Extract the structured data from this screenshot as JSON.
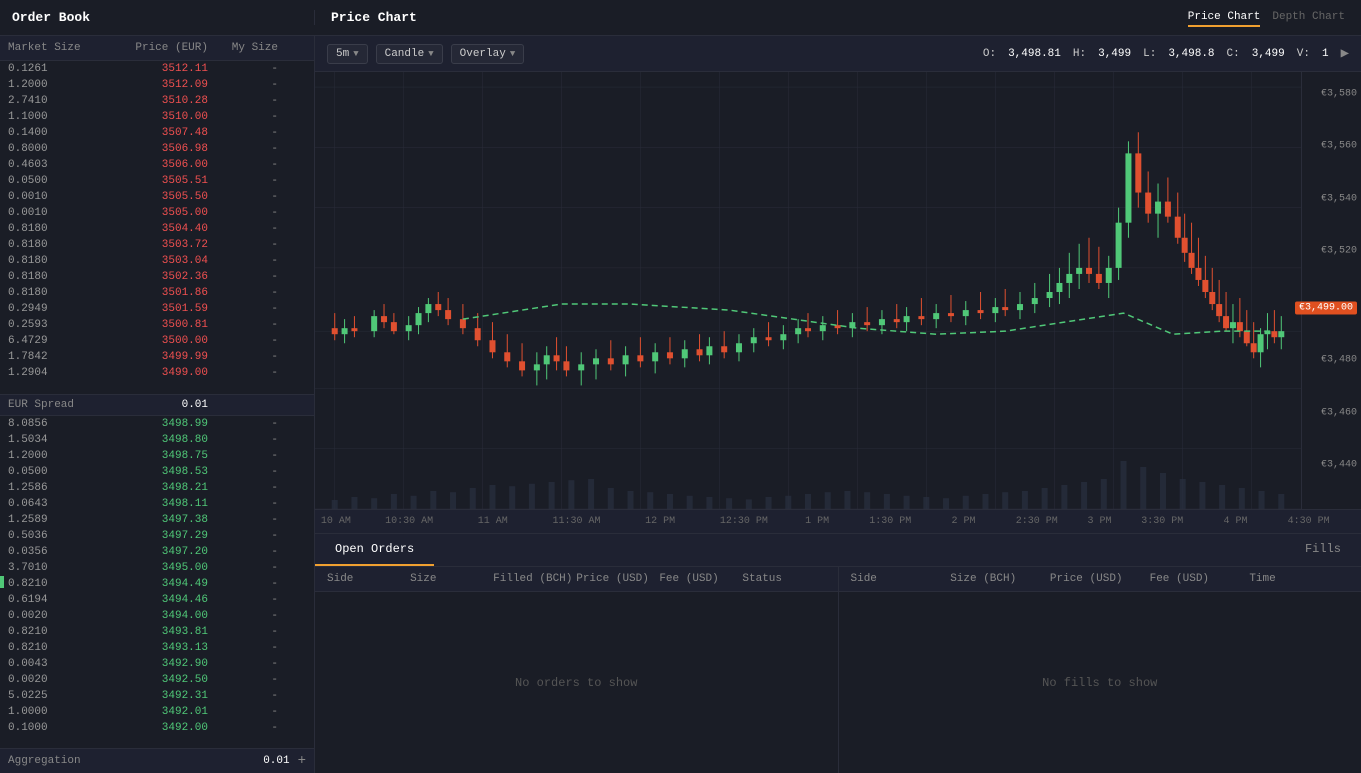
{
  "header": {
    "order_book_title": "Order Book",
    "price_chart_title": "Price Chart",
    "chart_tabs": [
      {
        "label": "Price Chart",
        "active": true
      },
      {
        "label": "Depth Chart",
        "active": false
      }
    ]
  },
  "controls": {
    "timeframe": "5m",
    "chart_type": "Candle",
    "overlay": "Overlay",
    "ohlcv": {
      "o_label": "O:",
      "o_val": "3,498.81",
      "h_label": "H:",
      "h_val": "3,499",
      "l_label": "L:",
      "l_val": "3,498.8",
      "c_label": "C:",
      "c_val": "3,499",
      "v_label": "V:",
      "v_val": "1"
    }
  },
  "order_book": {
    "columns": [
      "Market Size",
      "Price (EUR)",
      "My Size"
    ],
    "asks": [
      {
        "market_size": "0.1261",
        "price": "3512.11",
        "my_size": "-"
      },
      {
        "market_size": "1.2000",
        "price": "3512.09",
        "my_size": "-"
      },
      {
        "market_size": "2.7410",
        "price": "3510.28",
        "my_size": "-"
      },
      {
        "market_size": "1.1000",
        "price": "3510.00",
        "my_size": "-"
      },
      {
        "market_size": "0.1400",
        "price": "3507.48",
        "my_size": "-"
      },
      {
        "market_size": "0.8000",
        "price": "3506.98",
        "my_size": "-"
      },
      {
        "market_size": "0.4603",
        "price": "3506.00",
        "my_size": "-"
      },
      {
        "market_size": "0.0500",
        "price": "3505.51",
        "my_size": "-"
      },
      {
        "market_size": "0.0010",
        "price": "3505.50",
        "my_size": "-"
      },
      {
        "market_size": "0.0010",
        "price": "3505.00",
        "my_size": "-"
      },
      {
        "market_size": "0.8180",
        "price": "3504.40",
        "my_size": "-"
      },
      {
        "market_size": "0.8180",
        "price": "3503.72",
        "my_size": "-"
      },
      {
        "market_size": "0.8180",
        "price": "3503.04",
        "my_size": "-"
      },
      {
        "market_size": "0.8180",
        "price": "3502.36",
        "my_size": "-"
      },
      {
        "market_size": "0.8180",
        "price": "3501.86",
        "my_size": "-"
      },
      {
        "market_size": "0.2949",
        "price": "3501.59",
        "my_size": "-"
      },
      {
        "market_size": "0.2593",
        "price": "3500.81",
        "my_size": "-"
      },
      {
        "market_size": "6.4729",
        "price": "3500.00",
        "my_size": "-"
      },
      {
        "market_size": "1.7842",
        "price": "3499.99",
        "my_size": "-"
      },
      {
        "market_size": "1.2904",
        "price": "3499.00",
        "my_size": "-"
      }
    ],
    "spread_label": "EUR Spread",
    "spread_value": "0.01",
    "bids": [
      {
        "market_size": "8.0856",
        "price": "3498.99",
        "my_size": "-"
      },
      {
        "market_size": "1.5034",
        "price": "3498.80",
        "my_size": "-"
      },
      {
        "market_size": "1.2000",
        "price": "3498.75",
        "my_size": "-"
      },
      {
        "market_size": "0.0500",
        "price": "3498.53",
        "my_size": "-"
      },
      {
        "market_size": "1.2586",
        "price": "3498.21",
        "my_size": "-"
      },
      {
        "market_size": "0.0643",
        "price": "3498.11",
        "my_size": "-"
      },
      {
        "market_size": "1.2589",
        "price": "3497.38",
        "my_size": "-"
      },
      {
        "market_size": "0.5036",
        "price": "3497.29",
        "my_size": "-"
      },
      {
        "market_size": "0.0356",
        "price": "3497.20",
        "my_size": "-"
      },
      {
        "market_size": "3.7010",
        "price": "3495.00",
        "my_size": "-"
      },
      {
        "market_size": "0.8210",
        "price": "3494.49",
        "my_size": "-"
      },
      {
        "market_size": "0.6194",
        "price": "3494.46",
        "my_size": "-"
      },
      {
        "market_size": "0.0020",
        "price": "3494.00",
        "my_size": "-"
      },
      {
        "market_size": "0.8210",
        "price": "3493.81",
        "my_size": "-"
      },
      {
        "market_size": "0.8210",
        "price": "3493.13",
        "my_size": "-"
      },
      {
        "market_size": "0.0043",
        "price": "3492.90",
        "my_size": "-"
      },
      {
        "market_size": "0.0020",
        "price": "3492.50",
        "my_size": "-"
      },
      {
        "market_size": "5.0225",
        "price": "3492.31",
        "my_size": "-"
      },
      {
        "market_size": "1.0000",
        "price": "3492.01",
        "my_size": "-"
      },
      {
        "market_size": "0.1000",
        "price": "3492.00",
        "my_size": "-"
      }
    ],
    "aggregation_label": "Aggregation",
    "aggregation_value": "0.01"
  },
  "time_labels": [
    {
      "label": "10 AM",
      "pct": 2
    },
    {
      "label": "10:30 AM",
      "pct": 9
    },
    {
      "label": "11 AM",
      "pct": 17
    },
    {
      "label": "11:30 AM",
      "pct": 25
    },
    {
      "label": "12 PM",
      "pct": 33
    },
    {
      "label": "12:30 PM",
      "pct": 41
    },
    {
      "label": "1 PM",
      "pct": 48
    },
    {
      "label": "1:30 PM",
      "pct": 55
    },
    {
      "label": "2 PM",
      "pct": 62
    },
    {
      "label": "2:30 PM",
      "pct": 69
    },
    {
      "label": "3 PM",
      "pct": 75
    },
    {
      "label": "3:30 PM",
      "pct": 81
    },
    {
      "label": "4 PM",
      "pct": 88
    },
    {
      "label": "4:30 PM",
      "pct": 95
    }
  ],
  "price_levels": [
    {
      "label": "€3,580",
      "pct": 5
    },
    {
      "label": "€3,560",
      "pct": 17
    },
    {
      "label": "€3,540",
      "pct": 29
    },
    {
      "label": "€3,520",
      "pct": 41
    },
    {
      "label": "€3,499.00",
      "pct": 54,
      "current": true
    },
    {
      "label": "€3,480",
      "pct": 66
    },
    {
      "label": "€3,460",
      "pct": 78
    },
    {
      "label": "€3,440",
      "pct": 90
    }
  ],
  "bottom": {
    "open_orders_label": "Open Orders",
    "fills_label": "Fills",
    "orders_columns": [
      "Side",
      "Size",
      "Filled (BCH)",
      "Price (USD)",
      "Fee (USD)",
      "Status"
    ],
    "fills_columns": [
      "Side",
      "Size (BCH)",
      "Price (USD)",
      "Fee (USD)",
      "Time"
    ],
    "no_orders_text": "No orders to show",
    "no_fills_text": "No fills to show"
  },
  "colors": {
    "ask": "#f05050",
    "bid": "#50c878",
    "background": "#1a1d26",
    "panel": "#1e2130",
    "border": "#2a2d3a",
    "accent": "#f0a030",
    "current_price_bg": "#e05020",
    "candle_up": "#50c878",
    "candle_down": "#e05030"
  }
}
